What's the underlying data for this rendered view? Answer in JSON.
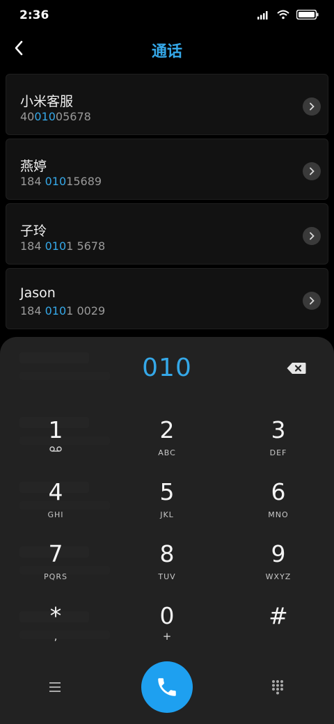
{
  "status": {
    "time": "2:36"
  },
  "header": {
    "title": "通话"
  },
  "contacts": [
    {
      "name": "小米客服",
      "number_pre": "40",
      "number_hl": "010",
      "number_post": "05678"
    },
    {
      "name": "燕婷",
      "number_pre": "184 ",
      "number_hl": "010",
      "number_post": "15689"
    },
    {
      "name": "子玲",
      "number_pre": "184 ",
      "number_hl": "010",
      "number_post": "1 5678"
    },
    {
      "name": "Jason",
      "number_pre": "184 ",
      "number_hl": "010",
      "number_post": "1 0029"
    }
  ],
  "dialpad": {
    "display": "010",
    "keys": [
      {
        "digit": "1",
        "sub": ""
      },
      {
        "digit": "2",
        "sub": "ABC"
      },
      {
        "digit": "3",
        "sub": "DEF"
      },
      {
        "digit": "4",
        "sub": "GHI"
      },
      {
        "digit": "5",
        "sub": "JKL"
      },
      {
        "digit": "6",
        "sub": "MNO"
      },
      {
        "digit": "7",
        "sub": "PQRS"
      },
      {
        "digit": "8",
        "sub": "TUV"
      },
      {
        "digit": "9",
        "sub": "WXYZ"
      },
      {
        "digit": "*",
        "sub": ","
      },
      {
        "digit": "0",
        "sub": "+"
      },
      {
        "digit": "#",
        "sub": ""
      }
    ]
  },
  "icons": {
    "back": "back-arrow-icon",
    "voicemail": "voicemail-icon",
    "backspace": "backspace-icon",
    "call": "phone-icon",
    "menu": "menu-icon",
    "dialpad_toggle": "dialpad-grid-icon"
  },
  "colors": {
    "accent": "#35a8e8",
    "call": "#1ea0f0"
  }
}
